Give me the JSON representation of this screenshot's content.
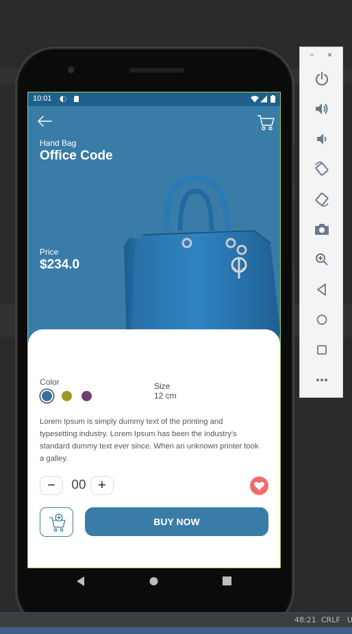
{
  "app": {
    "statusbar": {
      "time": "10:01"
    },
    "product": {
      "category": "Hand Bag",
      "name": "Office Code",
      "price_label": "Price",
      "price": "$234.0",
      "color_label": "Color",
      "colors": [
        "#356f9a",
        "#9b9b23",
        "#6f3f73"
      ],
      "selected_color_index": 0,
      "size_label": "Size",
      "size_value": "12 cm",
      "description": "Lorem Ipsum is simply dummy text of the printing and typesetting industry. Lorem Ipsum has been the industry's standard dummy text ever since. When an unknown printer took a galley."
    },
    "quantity": {
      "minus": "−",
      "value": "00",
      "plus": "+"
    },
    "buy_label": "BUY NOW",
    "icons": [
      "back-arrow-icon",
      "cart-icon",
      "heart-icon",
      "add-to-cart-icon"
    ],
    "accent": "#3a7ca8",
    "favorite_color": "#f26b6b"
  },
  "emulator_toolbar": {
    "window_buttons": [
      "−",
      "×"
    ],
    "icons": [
      "power-icon",
      "volume-up-icon",
      "volume-down-icon",
      "rotate-left-icon",
      "rotate-right-icon",
      "camera-icon",
      "zoom-icon",
      "back-icon",
      "home-icon",
      "overview-icon",
      "more-icon"
    ]
  },
  "ide_status": {
    "position": "48:21",
    "line_ending": "CRLF",
    "truncated": "U"
  }
}
